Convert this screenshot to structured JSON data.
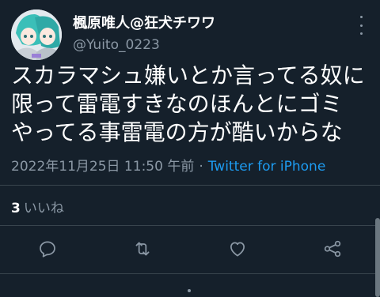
{
  "tweet": {
    "display_name": "楓原唯人@狂犬チワワ",
    "handle": "@Yuito_0223",
    "text_lines": [
      "スカラマシュ嫌いとか言ってる奴に",
      "限って雷電すきなのほんとにゴミ",
      "やってる事雷電の方が酷いからな"
    ],
    "timestamp": "2022年11月25日 11:50 午前",
    "separator": "·",
    "source": "Twitter for iPhone",
    "likes_count": "3",
    "likes_label": "いいね"
  },
  "icons": {
    "more": "more-icon",
    "reply": "reply-icon",
    "retweet": "retweet-icon",
    "like": "like-icon",
    "share": "share-icon"
  },
  "colors": {
    "background": "#15202b",
    "text": "#ffffff",
    "secondary": "#8b98a5",
    "link": "#1d9bf0",
    "divider": "#38444d"
  }
}
